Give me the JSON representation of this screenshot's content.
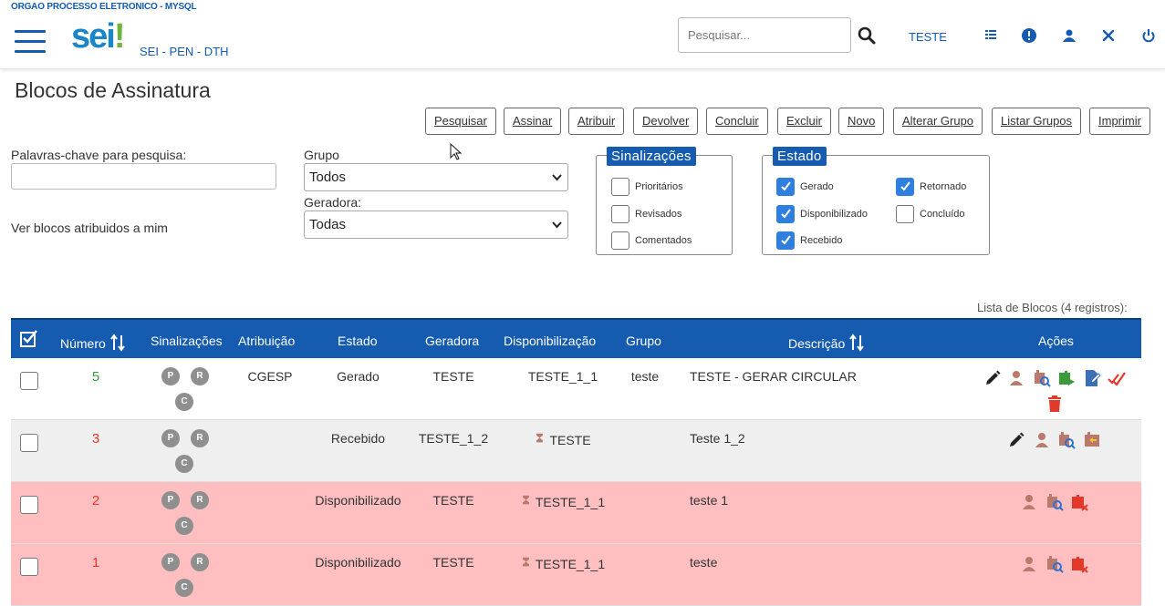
{
  "header": {
    "org": "ORGAO PROCESSO ELETRONICO - MYSQL",
    "logo": "sei",
    "logo_bang": "!",
    "app_name": "SEI - PEN - DTH",
    "search_placeholder": "Pesquisar...",
    "user": "TESTE",
    "icons": [
      "hamburger-menu-icon",
      "search-icon",
      "list-icon",
      "info-icon",
      "user-icon",
      "tools-icon",
      "power-icon"
    ]
  },
  "page": {
    "title": "Blocos de Assinatura",
    "buttons": [
      "Pesquisar",
      "Assinar",
      "Atribuir",
      "Devolver",
      "Concluir",
      "Excluir",
      "Novo",
      "Alterar Grupo",
      "Listar Grupos",
      "Imprimir"
    ]
  },
  "filters": {
    "keywords_label": "Palavras-chave para pesquisa:",
    "keywords_value": "",
    "assigned_label": "Ver blocos atribuidos a mim",
    "grupo_label": "Grupo",
    "grupo_value": "Todos",
    "geradora_label": "Geradora:",
    "geradora_value": "Todas"
  },
  "sinalizacoes": {
    "legend": "Sinalizações",
    "options": [
      {
        "label": "Prioritários",
        "checked": false
      },
      {
        "label": "Revisados",
        "checked": false
      },
      {
        "label": "Comentados",
        "checked": false
      }
    ]
  },
  "estado": {
    "legend": "Estado",
    "options": [
      {
        "label": "Gerado",
        "checked": true
      },
      {
        "label": "Disponibilizado",
        "checked": true
      },
      {
        "label": "Recebido",
        "checked": true
      },
      {
        "label": "Retornado",
        "checked": true
      },
      {
        "label": "Concluído",
        "checked": false
      }
    ]
  },
  "table": {
    "caption": "Lista de Blocos (4 registros):",
    "headers": [
      "Número",
      "Sinalizações",
      "Atribuição",
      "Estado",
      "Geradora",
      "Disponibilização",
      "Grupo",
      "Descrição",
      "Ações"
    ],
    "rows": [
      {
        "numero": "5",
        "badges": [
          "P",
          "R",
          "C"
        ],
        "atribuicao": "CGESP",
        "estado": "Gerado",
        "geradora": "TESTE",
        "disponibilizacao": "TESTE_1_1",
        "grupo": "teste",
        "descricao": "TESTE - GERAR CIRCULAR",
        "bg": "#ffffff",
        "num_color": "#3c9a3c"
      },
      {
        "numero": "3",
        "badges": [
          "P",
          "R",
          "C"
        ],
        "atribuicao": "",
        "estado": "Recebido",
        "geradora": "TESTE_1_2",
        "disponibilizacao": "TESTE",
        "grupo": "",
        "descricao": "Teste 1_2",
        "bg": "#efefef",
        "num_color": "#e2392a"
      },
      {
        "numero": "2",
        "badges": [
          "P",
          "R",
          "C"
        ],
        "atribuicao": "",
        "estado": "Disponibilizado",
        "geradora": "TESTE",
        "disponibilizacao": "TESTE_1_1",
        "grupo": "",
        "descricao": "teste 1",
        "bg": "#ffbfc0",
        "num_color": "#e2392a"
      },
      {
        "numero": "1",
        "badges": [
          "P",
          "R",
          "C"
        ],
        "atribuicao": "",
        "estado": "Disponibilizado",
        "geradora": "TESTE",
        "disponibilizacao": "TESTE_1_1",
        "grupo": "",
        "descricao": "teste",
        "bg": "#ffbfc0",
        "num_color": "#e2392a"
      }
    ]
  },
  "colors": {
    "primary": "#155bb0",
    "logo_blue": "#1a86c8",
    "logo_green": "#6fb43f",
    "row_disponibilizado": "#ffbfc0"
  }
}
